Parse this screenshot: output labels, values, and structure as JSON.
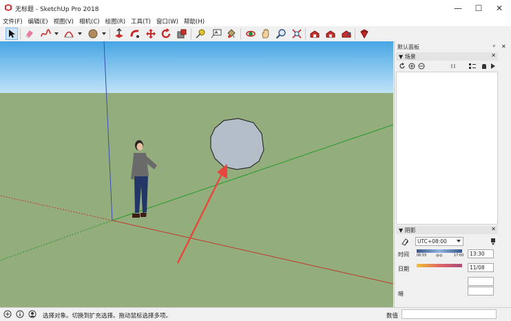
{
  "window": {
    "title": "无标题 - SketchUp Pro 2018",
    "minimize_glyph": "—",
    "maximize_glyph": "☐",
    "close_glyph": "✕"
  },
  "menubar": {
    "items": [
      "文件(F)",
      "编辑(E)",
      "视图(V)",
      "相机(C)",
      "绘图(R)",
      "工具(T)",
      "窗口(W)",
      "帮助(H)"
    ]
  },
  "toolbar": {
    "tools": [
      "select-tool",
      "eraser-tool",
      "freehand-tool",
      "arc-tool",
      "shape-tool",
      "push-pull-tool",
      "follow-me-tool",
      "move-tool",
      "rotate-tool",
      "scale-tool",
      "tape-measure-tool",
      "text-tool",
      "paint-bucket-tool",
      "orbit-tool",
      "pan-tool",
      "zoom-tool",
      "zoom-extents-tool",
      "warehouse-tool",
      "extension-warehouse-tool",
      "share-model-tool",
      "ruby-tool"
    ]
  },
  "panel": {
    "title": "默认面板",
    "pin_glyph": "ᵖ",
    "close_glyph": "✕",
    "scenes": {
      "header": "▼ 场景",
      "close_glyph": "✕"
    },
    "shadows": {
      "header": "▼ 阴影",
      "close_glyph": "✕",
      "timezone": "UTC+08:00",
      "time_label": "时间",
      "time_value": "13:30",
      "time_start": "06:55",
      "time_noon": "中午",
      "time_end": "17:00",
      "date_label": "日期",
      "date_value": "11/08",
      "partial_label": "暗"
    }
  },
  "statusbar": {
    "message": "选择对象。切换到扩充选择。拖动鼠标选择多项。",
    "measurements_label": "数值"
  },
  "colors": {
    "sky_top": "#47a6e4",
    "ground": "#94ad7c",
    "sphere_fill": "#b4bec9",
    "arrow": "#e8453c",
    "blue_axis": "#3a4fb0",
    "green_axis": "#1f9a2a",
    "red_axis": "#c0392b"
  }
}
